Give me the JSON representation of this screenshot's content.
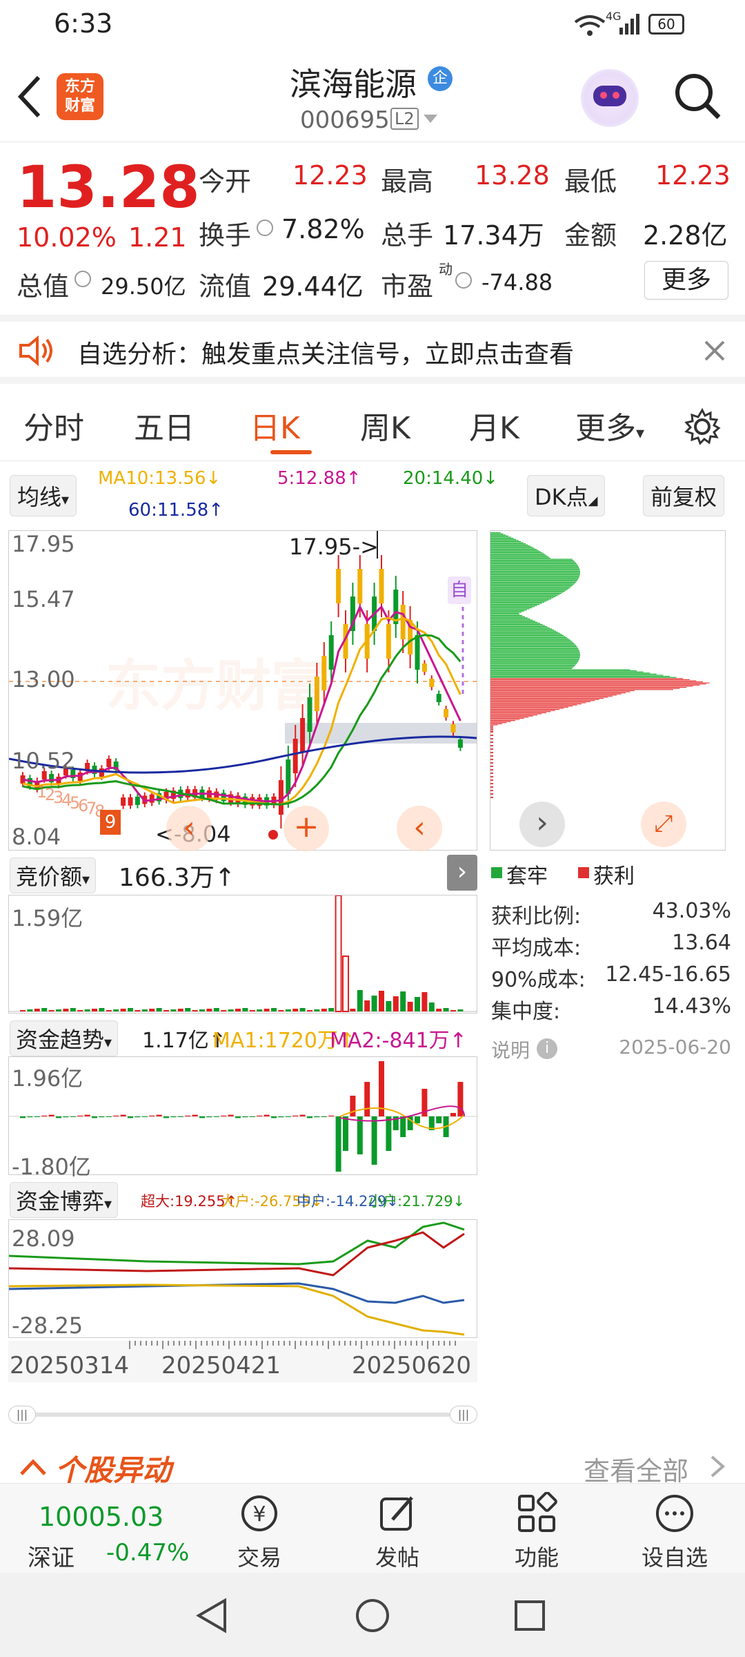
{
  "status": {
    "time": "6:33",
    "network": "4G",
    "battery": "60"
  },
  "header": {
    "logo": "东方\n财富",
    "title": "滨海能源",
    "badge": "企",
    "code": "000695",
    "level": "L2"
  },
  "quote": {
    "price": "13.28",
    "pct": "10.02%",
    "chg": "1.21",
    "open_l": "今开",
    "open_v": "12.23",
    "high_l": "最高",
    "high_v": "13.28",
    "low_l": "最低",
    "low_v": "12.23",
    "turn_l": "换手",
    "turn_v": "7.82%",
    "vol_l": "总手",
    "vol_v": "17.34万",
    "amt_l": "金额",
    "amt_v": "2.28亿",
    "mcap_l": "总值",
    "mcap_v": "29.50亿",
    "float_l": "流值",
    "float_v": "29.44亿",
    "pe_l": "市盈",
    "pe_sup": "动",
    "pe_v": "-74.88",
    "more": "更多"
  },
  "banner": {
    "text": "自选分析：触发重点关注信号，立即点击查看"
  },
  "tabs": [
    "分时",
    "五日",
    "日K",
    "周K",
    "月K",
    "更多"
  ],
  "ma": {
    "btn": "均线",
    "ma10": "MA10:13.56↓",
    "ma5": "5:12.88↑",
    "ma20": "20:14.40↓",
    "ma60": "60:11.58↑",
    "dk": "DK点",
    "fq": "前复权"
  },
  "kchart": {
    "y_top": "17.95",
    "y2": "15.47",
    "y3": "13.00",
    "y4": "10.52",
    "y_bot": "8.04",
    "high_anno": "17.95->",
    "low_anno": "<-8.04",
    "self_tag": "自",
    "nine": "9",
    "watermark": "东方财富"
  },
  "chip": {
    "legend_trap": "套牢",
    "legend_profit": "获利",
    "rows": [
      {
        "k": "获利比例:",
        "v": "43.03%"
      },
      {
        "k": "平均成本:",
        "v": "13.64"
      },
      {
        "k": "90%成本:",
        "v": "12.45-16.65"
      },
      {
        "k": "集中度:",
        "v": "14.43%"
      }
    ],
    "note": "说明",
    "date": "2025-06-20"
  },
  "bid": {
    "btn": "竞价额",
    "val": "166.3万↑",
    "ymax": "1.59亿"
  },
  "fund": {
    "btn": "资金趋势",
    "val": "1.17亿↑",
    "ma1": "MA1:1720万↑",
    "ma2": "MA2:-841万↑",
    "ymax": "1.96亿",
    "ymin": "-1.80亿"
  },
  "game": {
    "btn": "资金博弈",
    "super": "超大:19.255↑",
    "big": "大户:-26.755↓",
    "mid": "中户:-14.229↓",
    "small": "小户:21.729↓",
    "ymax": "28.09",
    "ymin": "-28.25"
  },
  "dates": [
    "20250314",
    "20250421",
    "20250620"
  ],
  "section": {
    "title": "个股异动",
    "more": "查看全部"
  },
  "nav": {
    "index_val": "10005.03",
    "index_name": "深证",
    "index_pct": "-0.47%",
    "items": [
      "交易",
      "发帖",
      "功能",
      "设自选"
    ]
  },
  "colors": {
    "up": "#e02020",
    "down": "#0a9a2a",
    "accent": "#e8541a",
    "ma5": "#c8168f",
    "ma10": "#f0b000",
    "ma20": "#1a9a1a",
    "ma60": "#1a2aa0"
  }
}
